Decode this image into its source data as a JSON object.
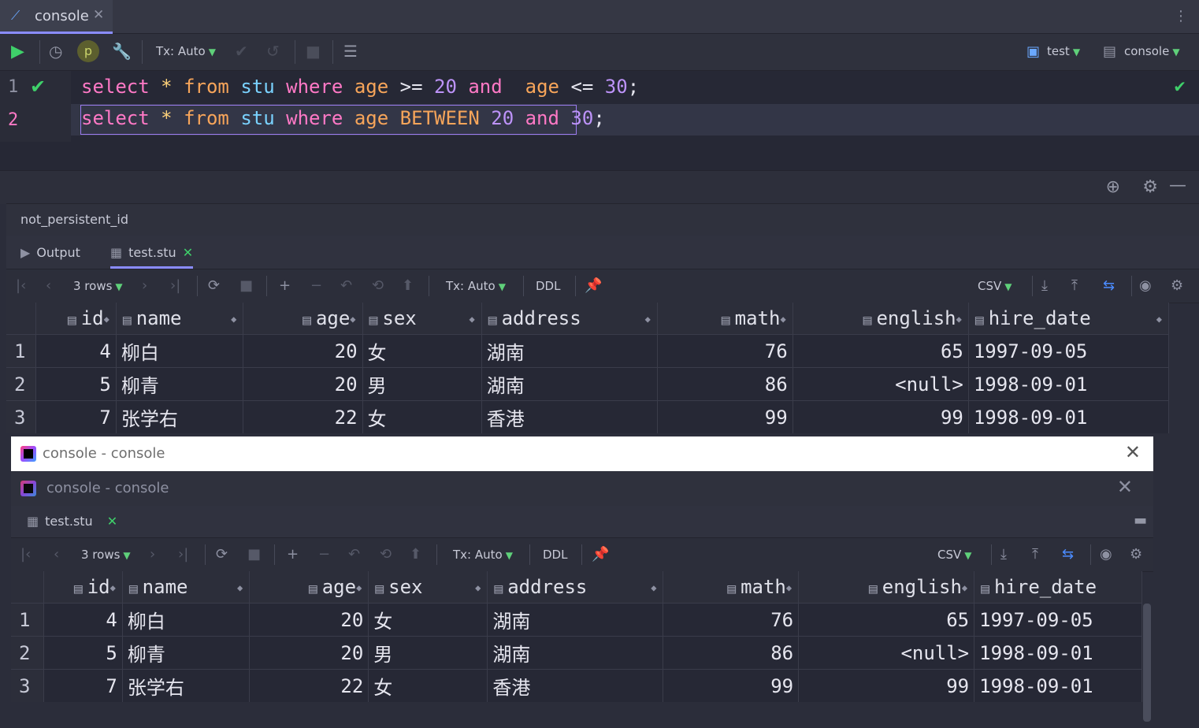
{
  "editor_tab": {
    "label": "console",
    "close": "✕"
  },
  "toolbar": {
    "tx_mode": "Tx: Auto",
    "datasource": "test",
    "session": "console"
  },
  "editor": {
    "line_numbers": [
      "1",
      "2"
    ],
    "line1": {
      "t1": "select",
      "t2": "*",
      "t3": "from",
      "t4": "stu",
      "t5": "where",
      "t6": "age",
      "t7": ">=",
      "t8": "20",
      "t9": "and",
      "t10": "age",
      "t11": "<=",
      "t12": "30",
      "t13": ";"
    },
    "line2": {
      "t1": "select",
      "t2": "*",
      "t3": "from",
      "t4": "stu",
      "t5": "where",
      "t6": "age",
      "t7": "BETWEEN",
      "t8": "20",
      "t9": "and",
      "t10": "30",
      "t11": ";"
    }
  },
  "services": {
    "session_label": "not_persistent_id",
    "tabs": {
      "output": "Output",
      "result": "test.stu",
      "close": "✕"
    }
  },
  "result_toolbar": {
    "rows": "3 rows",
    "tx_mode": "Tx: Auto",
    "ddl": "DDL",
    "export_format": "CSV"
  },
  "grid": {
    "columns": [
      "id",
      "name",
      "age",
      "sex",
      "address",
      "math",
      "english",
      "hire_date"
    ],
    "rows": [
      {
        "n": "1",
        "id": "4",
        "name": "柳白",
        "age": "20",
        "sex": "女",
        "address": "湖南",
        "math": "76",
        "english": "65",
        "hire_date": "1997-09-05"
      },
      {
        "n": "2",
        "id": "5",
        "name": "柳青",
        "age": "20",
        "sex": "男",
        "address": "湖南",
        "math": "86",
        "english": "<null>",
        "hire_date": "1998-09-01"
      },
      {
        "n": "3",
        "id": "7",
        "name": "张学右",
        "age": "22",
        "sex": "女",
        "address": "香港",
        "math": "99",
        "english": "99",
        "hire_date": "1998-09-01"
      }
    ]
  },
  "window": {
    "title": "console - console",
    "inner_title": "console - console",
    "tab_label": "test.stu"
  }
}
